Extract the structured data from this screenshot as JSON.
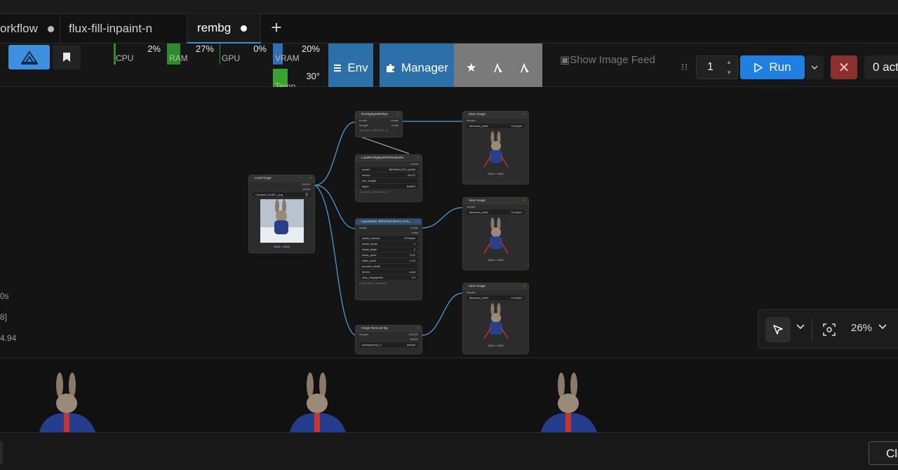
{
  "tabs": [
    {
      "label": "orkflow",
      "modified": true
    },
    {
      "label": "flux-fill-inpaint-n",
      "modified": false
    },
    {
      "label": "rembg",
      "modified": true,
      "active": true
    }
  ],
  "tab_add_label": "+",
  "monitors": {
    "cpu": {
      "label": "CPU",
      "value": "2%"
    },
    "ram": {
      "label": "RAM",
      "value": "27%"
    },
    "gpu": {
      "label": "GPU",
      "value": "0%"
    },
    "vram": {
      "label": "VRAM",
      "value": "20%"
    },
    "temp": {
      "label": "Temp",
      "value": "30°"
    }
  },
  "toolbar": {
    "env_label": "Env",
    "manager_label": "Manager",
    "show_feed_label": "Show Image Feed",
    "queue_count": "1",
    "run_label": "Run",
    "cancel_symbol": "✕",
    "queue_label": "0 act"
  },
  "side_stats": [
    "0s",
    "8]",
    "4.94"
  ],
  "nodes": {
    "rembg_refnet": {
      "title": "RembgByBiRefNet",
      "rows": [
        [
          "model",
          "image"
        ],
        [
          "images",
          "mask"
        ]
      ],
      "footer": "(ComfyUI_BiRefNet_II)"
    },
    "load_model": {
      "title": "LoadRembgByBiRefNetModel",
      "out": "model",
      "widgets": [
        [
          "model",
          "BiRefNet-DIS_ep580"
        ],
        [
          "device",
          "AUTO"
        ],
        [
          "use_weight",
          ""
        ],
        [
          "dtype",
          "float32"
        ]
      ],
      "footer": "(ComfyUI_BiRefNet_II)"
    },
    "load_image": {
      "title": "Load Image",
      "outputs": [
        "IMAGE",
        "MASK"
      ],
      "file": "ComfyUI_01367_.png",
      "dims": "1024 × 1024"
    },
    "layermask": {
      "title": "LayerMask: BiRefNetUltraV2 (Adv...",
      "rows": [
        [
          "image",
          "image"
        ],
        [
          "",
          "mask"
        ]
      ],
      "widgets": [
        [
          "detail_method",
          "VITMatte"
        ],
        [
          "detail_erode",
          "4"
        ],
        [
          "detail_dilate",
          "2"
        ],
        [
          "black_point",
          "0.01"
        ],
        [
          "white_point",
          "0.99"
        ],
        [
          "process_detail",
          ""
        ],
        [
          "device",
          "cuda"
        ],
        [
          "max_megapixels",
          "2.0"
        ]
      ],
      "footer": "(LayerStyle_Advance)"
    },
    "image_rembg": {
      "title": "Image Remove Bg",
      "rows": [
        [
          "images",
          "IMAGE"
        ],
        [
          "",
          "MASK"
        ]
      ],
      "widgets": [
        [
          "transparency_b",
          "default"
        ]
      ]
    },
    "save1": {
      "title": "Save Image",
      "input": "images",
      "prefix_label": "filename_prefix",
      "prefix": "ComfyUI",
      "dims": "1024 × 1024"
    },
    "save2": {
      "title": "Save Image",
      "input": "images",
      "prefix_label": "filename_prefix",
      "prefix": "ComfyUI",
      "dims": "1024 × 1024"
    },
    "save3": {
      "title": "Save Image",
      "input": "images",
      "prefix_label": "filename_prefix",
      "prefix": "ComfyUI",
      "dims": "1024 × 1024"
    }
  },
  "canvas_controls": {
    "zoom": "26%"
  },
  "bottom": {
    "close_label": "Clo"
  },
  "colors": {
    "accent": "#1f7fe3",
    "node_wire": "#4fa3e0",
    "cancel": "#8c2f2f",
    "env": "#2d6fa8"
  }
}
